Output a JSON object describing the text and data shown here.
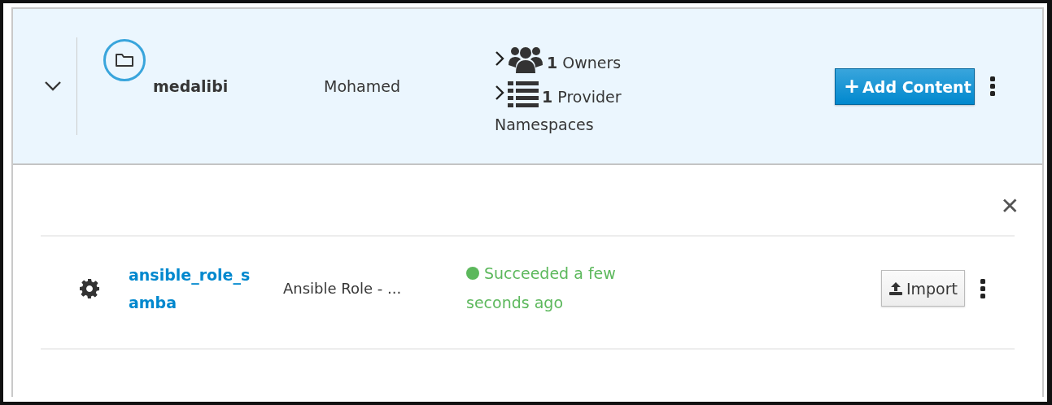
{
  "namespace": {
    "expanded": true,
    "name": "medalibi",
    "owner_name": "Mohamed",
    "owners": {
      "count": "1",
      "label": "Owners"
    },
    "providers": {
      "count": "1",
      "label": "Provider"
    },
    "section_label": "Namespaces",
    "add_button": {
      "icon": "+",
      "label": "Add Content"
    }
  },
  "content": {
    "close_icon": "✕",
    "rows": [
      {
        "name": "ansible_role_samba",
        "description": "Ansible Role - ...",
        "status": {
          "kind": "success",
          "text": "Succeeded a few seconds ago"
        },
        "import_label": "Import"
      }
    ]
  }
}
